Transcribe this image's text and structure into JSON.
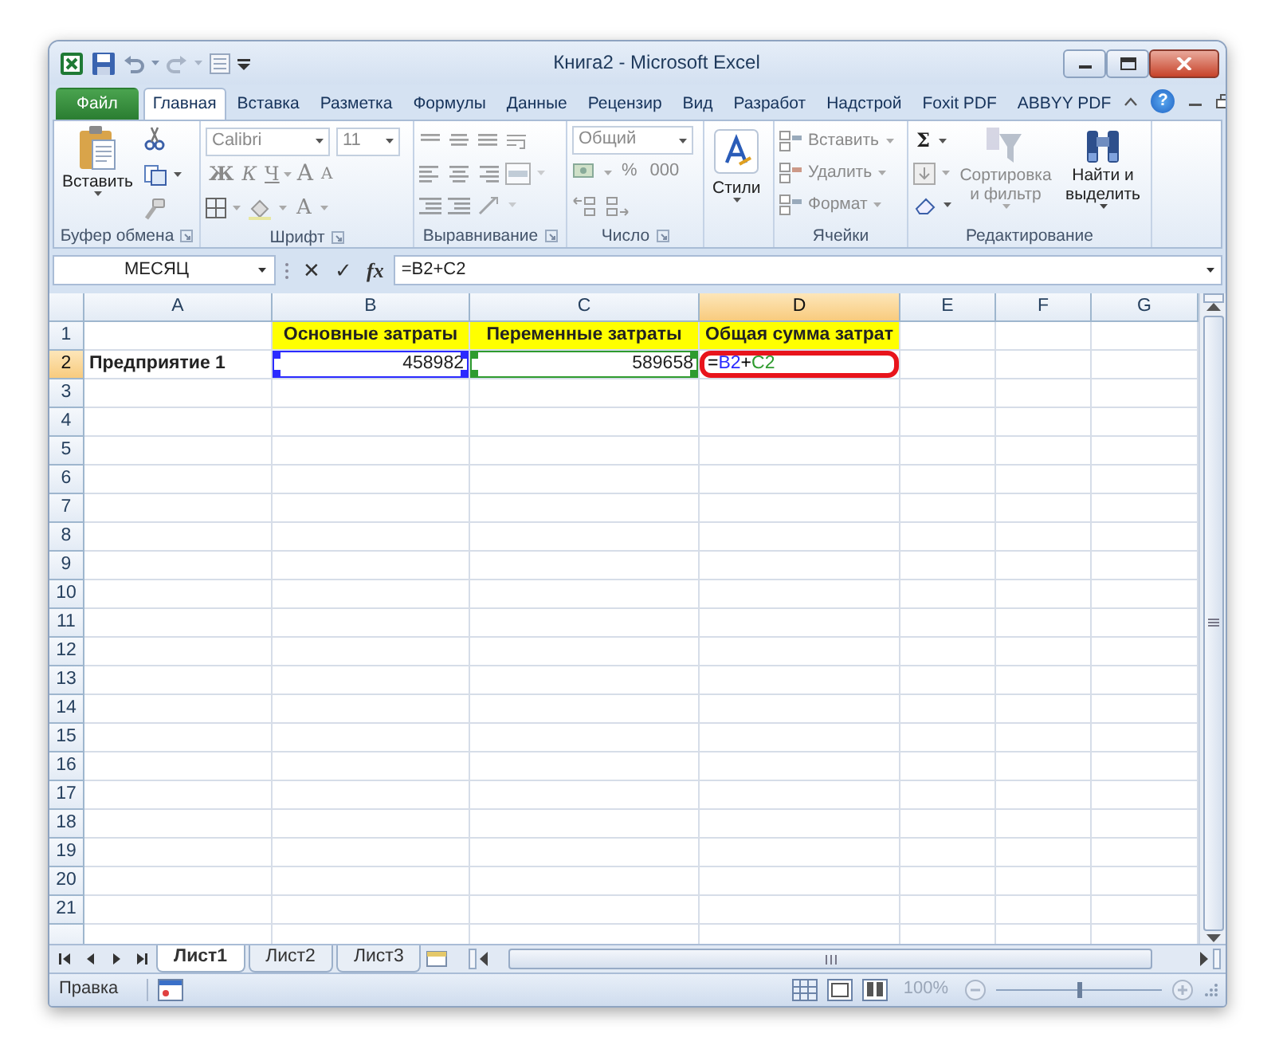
{
  "title_bar": {
    "title": "Книга2 - Microsoft Excel"
  },
  "tabs": [
    {
      "label": "Файл",
      "kind": "file",
      "selected": false
    },
    {
      "label": "Главная",
      "kind": "tab",
      "selected": true
    },
    {
      "label": "Вставка",
      "kind": "tab",
      "selected": false
    },
    {
      "label": "Разметка",
      "kind": "tab",
      "selected": false
    },
    {
      "label": "Формулы",
      "kind": "tab",
      "selected": false
    },
    {
      "label": "Данные",
      "kind": "tab",
      "selected": false
    },
    {
      "label": "Рецензир",
      "kind": "tab",
      "selected": false
    },
    {
      "label": "Вид",
      "kind": "tab",
      "selected": false
    },
    {
      "label": "Разработ",
      "kind": "tab",
      "selected": false
    },
    {
      "label": "Надстрой",
      "kind": "tab",
      "selected": false
    },
    {
      "label": "Foxit PDF",
      "kind": "tab",
      "selected": false
    },
    {
      "label": "ABBYY PDF",
      "kind": "tab",
      "selected": false
    }
  ],
  "help": "?",
  "ribbon": {
    "groups": [
      {
        "kind": "clipboard",
        "label": "Буфер обмена",
        "launcher": true,
        "paste": "Вставить",
        "disabled": false
      },
      {
        "kind": "font",
        "label": "Шрифт",
        "launcher": true,
        "disabled": true,
        "font_name": "Calibri",
        "font_size": "11",
        "buttons": [
          "Ж",
          "К",
          "Ч",
          "A",
          "A"
        ],
        "font_color": "A"
      },
      {
        "kind": "alignment",
        "label": "Выравнивание",
        "launcher": true,
        "disabled": true
      },
      {
        "kind": "number",
        "label": "Число",
        "launcher": true,
        "disabled": true,
        "format": "Общий",
        "buttons": [
          "%",
          "000"
        ]
      },
      {
        "kind": "styles",
        "button": "Стили",
        "disabled": false
      },
      {
        "kind": "cells",
        "label": "Ячейки",
        "items": [
          {
            "label": "Вставить",
            "disabled": true
          },
          {
            "label": "Удалить",
            "disabled": true
          },
          {
            "label": "Формат",
            "disabled": true
          }
        ]
      },
      {
        "kind": "editing",
        "label": "Редактирование",
        "sum": "Σ",
        "items": [
          {
            "label": "Сортировка и фильтр",
            "disabled": true
          },
          {
            "label": "Найти и выделить",
            "disabled": false
          }
        ]
      }
    ]
  },
  "formula_bar": {
    "name_box": "МЕСЯЦ",
    "cancel": "✕",
    "enter": "✓",
    "fx": "fx",
    "formula": "=B2+C2"
  },
  "grid": {
    "columns": [
      {
        "label": "A",
        "selected": false
      },
      {
        "label": "B",
        "selected": false
      },
      {
        "label": "C",
        "selected": false
      },
      {
        "label": "D",
        "selected": true
      },
      {
        "label": "E",
        "selected": false
      },
      {
        "label": "F",
        "selected": false
      },
      {
        "label": "G",
        "selected": false
      }
    ],
    "rows": [
      {
        "label": "1",
        "selected": false,
        "cells": [
          {
            "kind": "empty"
          },
          {
            "kind": "text",
            "text": "Основные затраты",
            "bold": true,
            "highlighted": true
          },
          {
            "kind": "text",
            "text": "Переменные затраты",
            "bold": true,
            "highlighted": true
          },
          {
            "kind": "text",
            "text": "Общая сумма затрат",
            "bold": true,
            "highlighted": true
          }
        ]
      },
      {
        "label": "2",
        "selected": true,
        "cells": [
          {
            "kind": "text",
            "text": "Предприятие 1",
            "bold": true
          },
          {
            "kind": "number",
            "text": "458982",
            "color": "#2a2aff"
          },
          {
            "kind": "number",
            "text": "589658",
            "color": "#2e9b2e"
          },
          {
            "kind": "formula",
            "circled": true,
            "segments": [
              {
                "text": "=",
                "color": "#000000"
              },
              {
                "text": "B2",
                "color": "#2a2aff"
              },
              {
                "text": "+",
                "color": "#000000"
              },
              {
                "text": "C2",
                "color": "#2e9b2e"
              }
            ]
          }
        ]
      },
      {
        "label": "3",
        "selected": false
      },
      {
        "label": "4",
        "selected": false
      },
      {
        "label": "5",
        "selected": false
      },
      {
        "label": "6",
        "selected": false
      },
      {
        "label": "7",
        "selected": false
      },
      {
        "label": "8",
        "selected": false
      },
      {
        "label": "9",
        "selected": false
      },
      {
        "label": "10",
        "selected": false
      },
      {
        "label": "11",
        "selected": false
      },
      {
        "label": "12",
        "selected": false
      },
      {
        "label": "13",
        "selected": false
      },
      {
        "label": "14",
        "selected": false
      },
      {
        "label": "15",
        "selected": false
      },
      {
        "label": "16",
        "selected": false
      },
      {
        "label": "17",
        "selected": false
      },
      {
        "label": "18",
        "selected": false
      },
      {
        "label": "19",
        "selected": false
      },
      {
        "label": "20",
        "selected": false
      },
      {
        "label": "21",
        "selected": false
      }
    ]
  },
  "sheets": [
    {
      "label": "Лист1",
      "selected": true
    },
    {
      "label": "Лист2",
      "selected": false
    },
    {
      "label": "Лист3",
      "selected": false
    }
  ],
  "status_bar": {
    "mode": "Правка",
    "zoom": "100%",
    "zoom_slider": {
      "level": 0.5
    }
  }
}
